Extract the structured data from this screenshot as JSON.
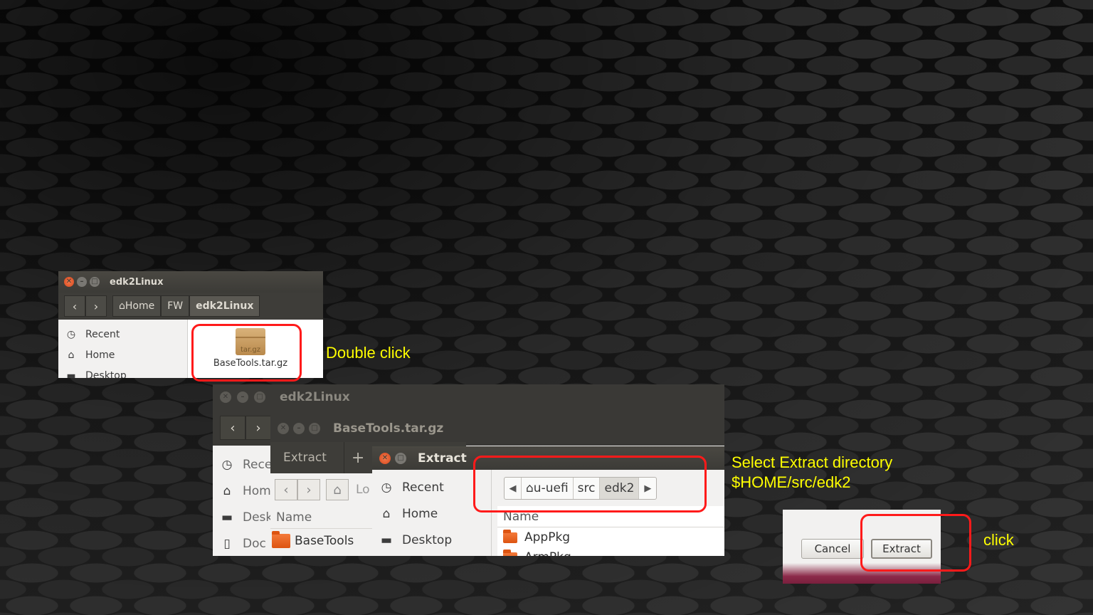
{
  "window1": {
    "title": "edk2Linux",
    "breadcrumbs": [
      "Home",
      "FW",
      "edk2Linux"
    ],
    "sidebar": [
      "Recent",
      "Home",
      "Desktop"
    ],
    "file": {
      "name": "BaseTools.tar.gz",
      "icon_label": "tar.gz"
    }
  },
  "window2": {
    "title": "edk2Linux",
    "sidebar": [
      "Rece",
      "Hom",
      "Desk",
      "Doc"
    ]
  },
  "archive_window": {
    "title": "BaseTools.tar.gz",
    "extract_label": "Extract",
    "add_label": "+",
    "location_label": "Lo",
    "column_name": "Name",
    "rows": [
      "BaseTools"
    ]
  },
  "extract_dialog": {
    "title": "Extract",
    "sidebar": [
      "Recent",
      "Home",
      "Desktop"
    ],
    "path": [
      "u-uefi",
      "src",
      "edk2"
    ],
    "column_name": "Name",
    "rows": [
      "AppPkg",
      "ArmPkg"
    ]
  },
  "buttons": {
    "cancel": "Cancel",
    "extract": "Extract"
  },
  "annotations": {
    "double_click": "Double  click",
    "select_dir_line1": "Select Extract directory",
    "select_dir_line2": "$HOME/src/edk2",
    "click": "click"
  },
  "colors": {
    "annotation": "#ffff00",
    "highlight": "#ff1a1a",
    "close_button": "#e95420",
    "folder": "#dd5411"
  }
}
